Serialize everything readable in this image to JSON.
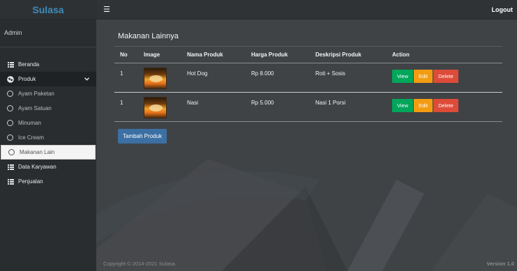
{
  "brand": "Sulasa",
  "header": {
    "menu_icon": "hamburger-icon",
    "logout_label": "Logout"
  },
  "user": {
    "name": "Admin"
  },
  "sidebar": {
    "items": [
      {
        "label": "Beranda",
        "icon": "grid-icon"
      },
      {
        "label": "Produk",
        "icon": "product-icon",
        "caret": "⌄"
      },
      {
        "label": "Ayam Paketan",
        "icon": "circle-icon"
      },
      {
        "label": "Ayam Satuan",
        "icon": "circle-icon"
      },
      {
        "label": "Minuman",
        "icon": "circle-icon"
      },
      {
        "label": "Ice Cream",
        "icon": "circle-icon"
      },
      {
        "label": "Makanan Lain",
        "icon": "circle-icon"
      },
      {
        "label": "Data Karyawan",
        "icon": "grid-icon"
      },
      {
        "label": "Penjualan",
        "icon": "grid-icon"
      }
    ]
  },
  "main": {
    "title": "Makanan Lainnya",
    "table": {
      "headers": [
        "No",
        "Image",
        "Nama Produk",
        "Harga Produk",
        "Deskripsi Produk",
        "Action"
      ],
      "rows": [
        {
          "no": "1",
          "name": "Hot Dog",
          "price": "Rp 8.000",
          "description": "Roti + Sosis"
        },
        {
          "no": "1",
          "name": "Nasi",
          "price": "Rp 5.000",
          "description": "Nasi 1 Porsi"
        }
      ],
      "actions": {
        "view": "View",
        "edit": "Edit",
        "delete": "Delete"
      }
    },
    "add_button": "Tambah Produk"
  },
  "footer": {
    "copyright": "Copyright © 2014-2021 Sulasa.",
    "version": "Version 1.0"
  },
  "colors": {
    "view": "#00a65a",
    "edit": "#f39c12",
    "delete": "#dd4b39",
    "add": "#3c6fa3",
    "brand": "#3c8dbc"
  }
}
